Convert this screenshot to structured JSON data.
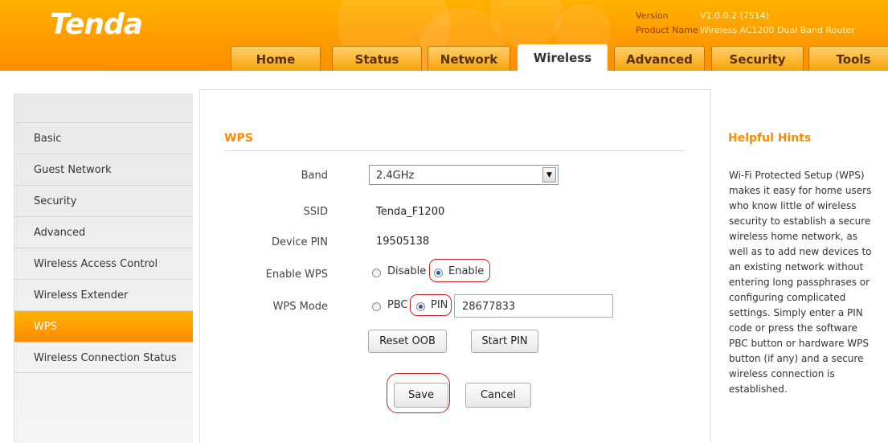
{
  "header": {
    "logo": "Tenda",
    "version_label": "Version",
    "version_value": "V1.0.0.2 (7514)",
    "product_label": "Product Name",
    "product_value": "Wireless AC1200 Dual Band Router"
  },
  "tabs": [
    "Home",
    "Status",
    "Network",
    "Wireless",
    "Advanced",
    "Security",
    "Tools"
  ],
  "active_tab": "Wireless",
  "sidebar": {
    "items": [
      "Basic",
      "Guest Network",
      "Security",
      "Advanced",
      "Wireless Access Control",
      "Wireless Extender",
      "WPS",
      "Wireless Connection Status"
    ],
    "active": "WPS"
  },
  "wps": {
    "title": "WPS",
    "band_label": "Band",
    "band_value": "2.4GHz",
    "ssid_label": "SSID",
    "ssid_value": "Tenda_F1200",
    "device_pin_label": "Device PIN",
    "device_pin_value": "19505138",
    "enable_label": "Enable WPS",
    "enable_options": [
      "Disable",
      "Enable"
    ],
    "enable_selected": "Enable",
    "mode_label": "WPS Mode",
    "mode_options": [
      "PBC",
      "PIN"
    ],
    "mode_selected": "PIN",
    "pin_value": "28677833",
    "reset_button": "Reset OOB",
    "start_pin_button": "Start PIN",
    "save_button": "Save",
    "cancel_button": "Cancel"
  },
  "hints": {
    "title": "Helpful Hints",
    "body": "Wi-Fi Protected Setup (WPS) makes it easy for home users who know little of wireless security to establish a secure wireless home network, as well as to add new devices to an existing network without entering long passphrases or configuring complicated settings. Simply enter a PIN code or press the software PBC button or hardware WPS button (if any) and a secure wireless connection is established."
  },
  "colors": {
    "brand_orange": "#ff9f00",
    "accent_text": "#ff8a00",
    "highlight_red": "#d02020"
  }
}
